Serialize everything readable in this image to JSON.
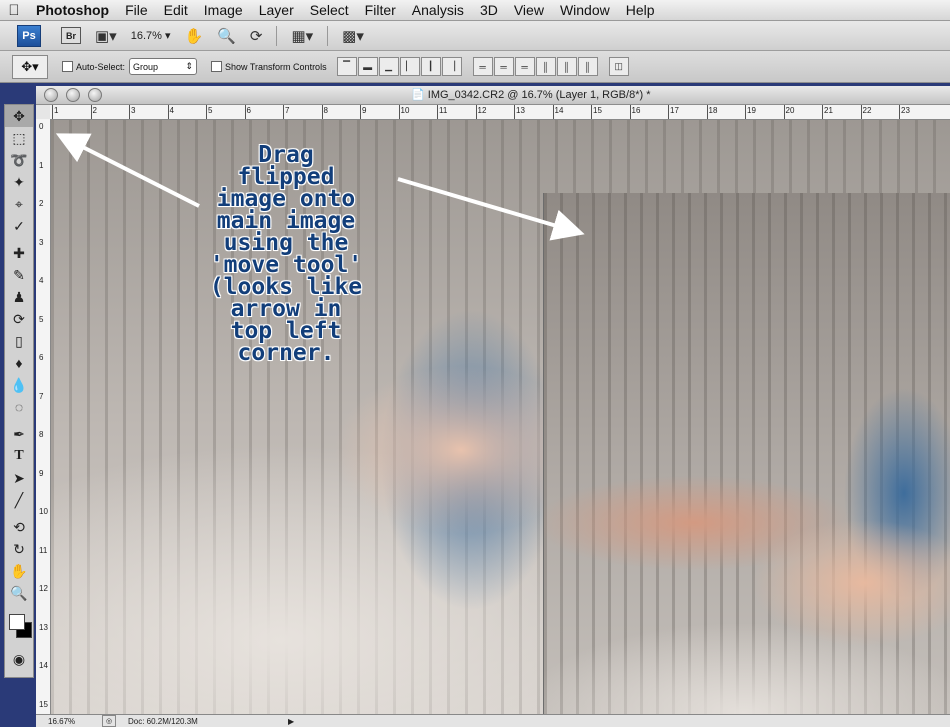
{
  "menu": {
    "apple_icon": "apple-icon",
    "items": [
      "Photoshop",
      "File",
      "Edit",
      "Image",
      "Layer",
      "Select",
      "Filter",
      "Analysis",
      "3D",
      "View",
      "Window",
      "Help"
    ]
  },
  "appbar": {
    "ps_logo": "Ps",
    "bridge_label": "Br",
    "zoom_level": "16.7%"
  },
  "options": {
    "auto_select_label": "Auto-Select:",
    "auto_select_value": "Group",
    "show_transform_label": "Show Transform Controls"
  },
  "document": {
    "title": "IMG_0342.CR2 @ 16.7% (Layer 1, RGB/8*) *"
  },
  "rulers": {
    "top": [
      "1",
      "2",
      "3",
      "4",
      "5",
      "6",
      "7",
      "8",
      "9",
      "10",
      "11",
      "12",
      "13",
      "14",
      "15",
      "16",
      "17",
      "18",
      "19",
      "20",
      "21",
      "22",
      "23"
    ],
    "left": [
      "0",
      "1",
      "2",
      "3",
      "4",
      "5",
      "6",
      "7",
      "8",
      "9",
      "10",
      "11",
      "12",
      "13",
      "14",
      "15"
    ]
  },
  "annotation": {
    "text_lines": [
      "Drag",
      "flipped",
      "image onto",
      "main image",
      "using the",
      "'move tool'",
      "(looks like",
      "arrow in",
      "top left",
      "corner."
    ],
    "color": "#123e7a"
  },
  "status": {
    "zoom": "16.67%",
    "doc_size": "Doc: 60.2M/120.3M"
  }
}
